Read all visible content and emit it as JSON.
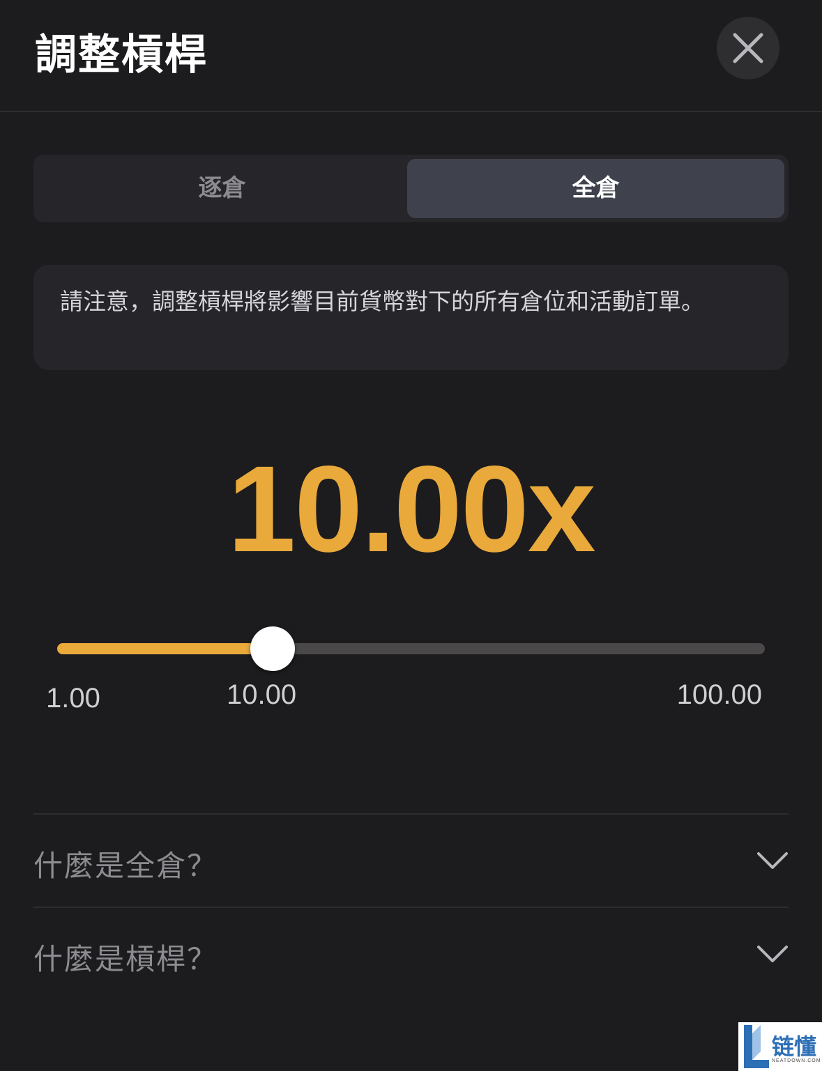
{
  "header": {
    "title": "調整槓桿",
    "close_icon": "close-icon"
  },
  "margin_mode": {
    "tabs": [
      {
        "label": "逐倉",
        "selected": false
      },
      {
        "label": "全倉",
        "selected": true
      }
    ]
  },
  "notice": {
    "text": "請注意，調整槓桿將影響目前貨幣對下的所有倉位和活動訂單。"
  },
  "leverage": {
    "display": "10.00x",
    "value": 10,
    "min": 1,
    "max": 100,
    "tick_labels": [
      "1.00",
      "10.00",
      "100.00"
    ]
  },
  "faq": [
    {
      "label": "什麼是全倉？",
      "icon": "chevron-down-icon"
    },
    {
      "label": "什麼是槓桿？",
      "icon": "chevron-down-icon"
    }
  ],
  "watermark": {
    "brand": "链懂",
    "domain": "NEATDOWN.COM"
  },
  "colors": {
    "accent": "#e9a93b",
    "background": "#1c1c1e",
    "panel": "#26262a",
    "selected_tab": "#3f424d"
  }
}
